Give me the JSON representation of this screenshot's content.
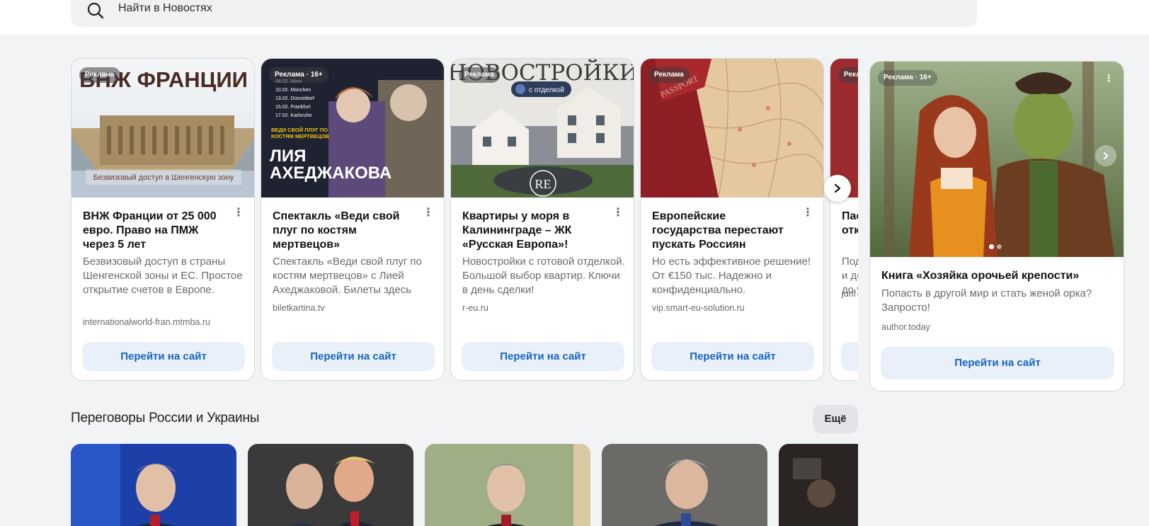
{
  "search": {
    "placeholder": "Найти в Новостях"
  },
  "ads": [
    {
      "badge": "Реклама",
      "title": "ВНЖ Франции от 25 000 евро. Право на ПМЖ через 5 лет",
      "description": "Безвизовый доступ в страны Шенгенской зоны и ЕС. Простое открытие счетов в Европе.",
      "domain": "internationalworld-fran.mtmba.ru",
      "button": "Перейти на сайт",
      "image_headline": "ВНЖ ФРАНЦИИ",
      "image_caption": "Безвизовый доступ в Шенгенскую зону"
    },
    {
      "badge": "Реклама · 16+",
      "title": "Спектакль «Веди свой плуг по костям мертвецов»",
      "description": "Спектакль «Веди свой плуг по костям мертвецов» с Лией Ахеджаковой. Билеты здесь",
      "domain": "biletkartina.tv",
      "button": "Перейти на сайт",
      "image_headline": "ЛИЯ АХЕДЖАКОВА",
      "image_subtitle": "ВЕДИ СВОЙ ПЛУГ ПО КОСТЯМ МЕРТВЕЦОВ",
      "image_dates": [
        "08.02. Wien",
        "10.02. München",
        "13.02. Düsseldorf",
        "15.02. Frankfurt",
        "17.02. Karlsruhe"
      ]
    },
    {
      "badge": "Реклама",
      "title": "Квартиры у моря в Калининграде – ЖК «Русская Европа»!",
      "description": "Новостройки с готовой отделкой. Большой выбор квартир. Ключи в день сделки!",
      "domain": "r-eu.ru",
      "button": "Перейти на сайт",
      "image_headline": "НОВОСТРОЙКИ",
      "image_pill": "с отделкой",
      "image_logo": "RE"
    },
    {
      "badge": "Реклама",
      "title": "Европейские государства перестают пускать Россиян",
      "description": "Но есть эффективное решение! От €150 тыс. Надежно и конфиденциально.",
      "domain": "vip.smart-eu-solution.ru",
      "button": "Перейти на сайт",
      "image_text": "PASSPORT"
    },
    {
      "badge": "Рекл",
      "title": "Пас отк",
      "description": "Под и до до у",
      "domain": "jurif",
      "button": "Пе"
    }
  ],
  "side_ad": {
    "badge": "Реклама · 16+",
    "title": "Книга «Хозяйка орочьей крепости»",
    "description": "Попасть в другой мир и стать женой орка? Запросто!",
    "domain": "author.today",
    "button": "Перейти на сайт",
    "slide_count": 2,
    "active_slide": 1
  },
  "section": {
    "title": "Переговоры России и Украины",
    "more_button": "Ещё"
  },
  "colors": {
    "accent": "#1565c0",
    "button_bg": "#e9f0fa",
    "page_bg": "#f2f3f5"
  }
}
